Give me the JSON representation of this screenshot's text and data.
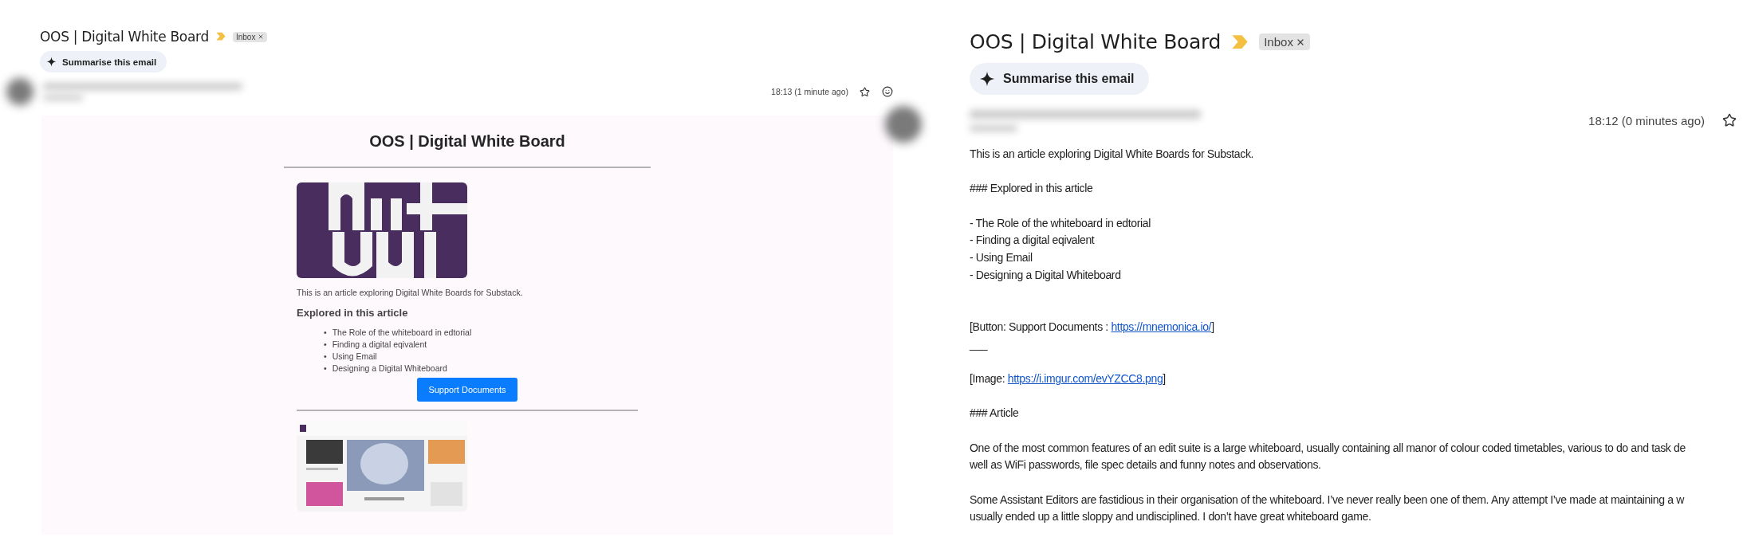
{
  "html_view": {
    "title": "OOS | Digital White Board",
    "label": "Inbox",
    "summarise": "Summarise this email",
    "time": "18:13 (1 minute ago)",
    "body": {
      "heading": "OOS | Digital White Board",
      "intro": "This is an article exploring Digital White Boards for Substack.",
      "subheading": "Explored in this article",
      "bullets": [
        "The Role of the whiteboard in edtorial",
        "Finding a digital eqivalent",
        "Using Email",
        "Designing a Digital Whiteboard"
      ],
      "marker": "•",
      "button": "Support Documents"
    }
  },
  "plain_view": {
    "title": "OOS | Digital White Board",
    "label": "Inbox",
    "summarise": "Summarise this email",
    "time": "18:12 (0 minutes ago)",
    "lines": [
      {
        "kind": "text",
        "text": "This is an article exploring Digital White Boards for Substack."
      },
      {
        "kind": "blank"
      },
      {
        "kind": "text",
        "text": "### Explored in this article"
      },
      {
        "kind": "blank"
      },
      {
        "kind": "text",
        "text": "- The Role of the whiteboard in edtorial"
      },
      {
        "kind": "text",
        "text": "- Finding a digital eqivalent"
      },
      {
        "kind": "text",
        "text": "- Using Email"
      },
      {
        "kind": "text",
        "text": "- Designing a Digital Whiteboard"
      },
      {
        "kind": "blank"
      },
      {
        "kind": "blank"
      },
      {
        "kind": "link",
        "before": "[Button: Support Documents  : ",
        "link": "https://mnemonica.io/",
        "after": "]"
      },
      {
        "kind": "text",
        "text": "___"
      },
      {
        "kind": "blank"
      },
      {
        "kind": "link",
        "before": "[Image: ",
        "link": "https://i.imgur.com/evYZCC8.png",
        "after": "]"
      },
      {
        "kind": "blank"
      },
      {
        "kind": "text",
        "text": "### Article"
      },
      {
        "kind": "blank"
      },
      {
        "kind": "text",
        "text": "One of the most common features of an edit suite is a large whiteboard, usually containing all manor of colour coded timetables, various to do and task de"
      },
      {
        "kind": "text",
        "text": "well as WiFi passwords, file spec details and funny notes and observations."
      },
      {
        "kind": "blank"
      },
      {
        "kind": "text",
        "text": "Some Assistant Editors are fastidious in their organisation of the whiteboard. I’ve never really been one of them. Any attempt I’ve made at maintaining a w"
      },
      {
        "kind": "text",
        "text": "usually ended up a little sloppy and undisciplined. I don’t have great whiteboard game."
      }
    ]
  }
}
